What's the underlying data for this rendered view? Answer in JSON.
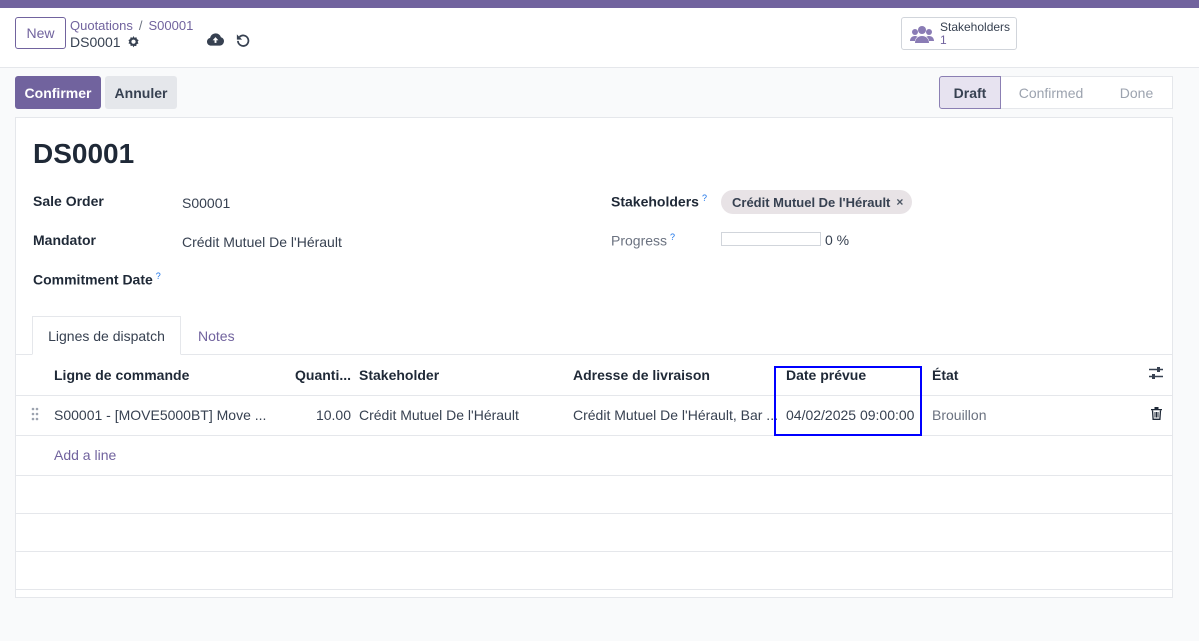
{
  "breadcrumb": {
    "parent": "Quotations",
    "separator": "/",
    "current": "S00001"
  },
  "record_ref": "DS0001",
  "buttons": {
    "new": "New",
    "confirm": "Confirmer",
    "cancel": "Annuler"
  },
  "smart_button": {
    "label": "Stakeholders",
    "count": "1"
  },
  "statusbar": {
    "stages": [
      "Draft",
      "Confirmed",
      "Done"
    ],
    "active": "Draft"
  },
  "form": {
    "title": "DS0001",
    "sale_order_label": "Sale Order",
    "sale_order_value": "S00001",
    "mandator_label": "Mandator",
    "mandator_value": "Crédit Mutuel De l'Hérault",
    "commitment_label": "Commitment Date",
    "help_mark": "?",
    "stakeholders_label": "Stakeholders",
    "stakeholder_tag": "Crédit Mutuel De l'Hérault",
    "tag_remove": "×",
    "progress_label": "Progress",
    "progress_value": 0,
    "progress_text": "0 %"
  },
  "tabs": [
    "Lignes de dispatch",
    "Notes"
  ],
  "table": {
    "columns": [
      "Ligne de commande",
      "Quanti...",
      "Stakeholder",
      "Adresse de livraison",
      "Date prévue",
      "État"
    ],
    "rows": [
      {
        "line": "S00001 - [MOVE5000BT] Move ...",
        "qty": "10.00",
        "stakeholder": "Crédit Mutuel De l'Hérault",
        "address": "Crédit Mutuel De l'Hérault, Bar ...",
        "date": "04/02/2025 09:00:00",
        "state": "Brouillon"
      }
    ],
    "add_line": "Add a line"
  },
  "colors": {
    "primary": "#71639e",
    "highlight": "#0000ff"
  },
  "icons": [
    "gear-icon",
    "cloud-upload-icon",
    "undo-icon",
    "users-icon",
    "drag-handle-icon",
    "column-settings-icon",
    "trash-icon"
  ]
}
